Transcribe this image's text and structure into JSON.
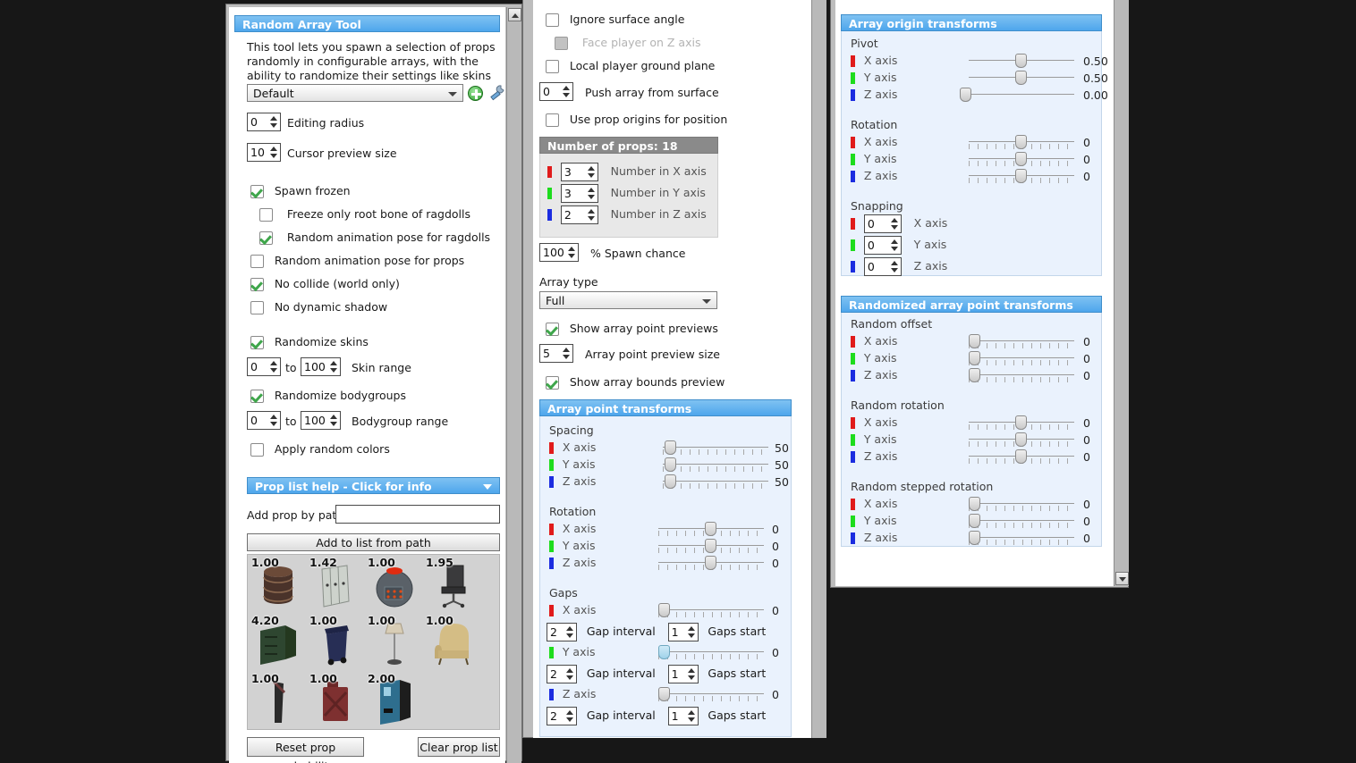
{
  "left_panel": {
    "title": "Random Array Tool",
    "description": "This tool lets you spawn a selection of props randomly in configurable arrays, with the ability to randomize their settings like skins and bodygroups.",
    "preset": {
      "value": "Default",
      "add_icon": "add-preset-icon",
      "wrench_icon": "edit-preset-icon"
    },
    "editing_radius": {
      "value": "0",
      "label": "Editing radius"
    },
    "cursor_preview_size": {
      "value": "10",
      "label": "Cursor preview size"
    },
    "checkboxes": [
      {
        "label": "Spawn frozen",
        "checked": true,
        "indent": 0
      },
      {
        "label": "Freeze only root bone of ragdolls",
        "checked": false,
        "indent": 1
      },
      {
        "label": "Random animation pose for ragdolls",
        "checked": true,
        "indent": 1
      },
      {
        "label": "Random animation pose for props",
        "checked": false,
        "indent": 0
      },
      {
        "label": "No collide (world only)",
        "checked": true,
        "indent": 0
      },
      {
        "label": "No dynamic shadow",
        "checked": false,
        "indent": 0
      },
      {
        "label": "Randomize skins",
        "checked": true,
        "indent": 0
      },
      {
        "label": "Randomize bodygroups",
        "checked": true,
        "indent": 0
      },
      {
        "label": "Apply random colors",
        "checked": false,
        "indent": 0
      }
    ],
    "skin_range": {
      "from": "0",
      "to_label": "to",
      "to": "100",
      "label": "Skin range"
    },
    "bodygroup_range": {
      "from": "0",
      "to_label": "to",
      "to": "100",
      "label": "Bodygroup range"
    },
    "prop_list": {
      "header": "Prop list help - Click for info",
      "add_by_path_label": "Add prop by path",
      "add_by_path_value": "",
      "add_button": "Add to list from path",
      "reset_button": "Reset prop probability",
      "clear_button": "Clear prop list",
      "props": [
        {
          "probability": "1.00",
          "icon": "prop-barrel"
        },
        {
          "probability": "1.42",
          "icon": "prop-lockers"
        },
        {
          "probability": "1.00",
          "icon": "prop-combine-ball"
        },
        {
          "probability": "1.95",
          "icon": "prop-office-chair"
        },
        {
          "probability": "4.20",
          "icon": "prop-filing-cabinet"
        },
        {
          "probability": "1.00",
          "icon": "prop-trash-bin"
        },
        {
          "probability": "1.00",
          "icon": "prop-floor-lamp"
        },
        {
          "probability": "1.00",
          "icon": "prop-armchair"
        },
        {
          "probability": "1.00",
          "icon": "prop-plank"
        },
        {
          "probability": "1.00",
          "icon": "prop-jerry-can"
        },
        {
          "probability": "2.00",
          "icon": "prop-vending-machine"
        }
      ]
    }
  },
  "middle_panel": {
    "checkboxes": [
      {
        "label": "Ignore surface angle",
        "checked": false,
        "disabled": false,
        "indent": 0
      },
      {
        "label": "Face player on Z axis",
        "checked": false,
        "disabled": true,
        "indent": 1
      },
      {
        "label": "Local player ground plane",
        "checked": false,
        "disabled": false,
        "indent": 0
      },
      {
        "label": "Use prop origins for position",
        "checked": false,
        "disabled": false,
        "indent": 0
      }
    ],
    "push_array": {
      "value": "0",
      "label": "Push array from surface"
    },
    "number_of_props": {
      "header": "Number of props: 18",
      "rows": [
        {
          "axis": "X",
          "color": "#e01b1b",
          "value": "3",
          "label": "Number in X axis"
        },
        {
          "axis": "Y",
          "color": "#1ddc1d",
          "value": "3",
          "label": "Number in Y axis"
        },
        {
          "axis": "Z",
          "color": "#1b2ce0",
          "value": "2",
          "label": "Number in Z axis"
        }
      ]
    },
    "spawn_chance": {
      "value": "100",
      "label": "% Spawn chance"
    },
    "array_type": {
      "label": "Array type",
      "value": "Full"
    },
    "show_point_previews": {
      "label": "Show array point previews",
      "checked": true
    },
    "point_preview_size": {
      "value": "5",
      "label": "Array point preview size"
    },
    "show_bounds_preview": {
      "label": "Show array bounds preview",
      "checked": true
    },
    "array_point_transforms": {
      "header": "Array point transforms",
      "spacing_label": "Spacing",
      "spacing": [
        {
          "axis": "X axis",
          "color": "#e01b1b",
          "value": "50",
          "pos": 2,
          "ticks": true
        },
        {
          "axis": "Y axis",
          "color": "#1ddc1d",
          "value": "50",
          "pos": 2,
          "ticks": true
        },
        {
          "axis": "Z axis",
          "color": "#1b2ce0",
          "value": "50",
          "pos": 2,
          "ticks": true
        }
      ],
      "rotation_label": "Rotation",
      "rotation": [
        {
          "axis": "X axis",
          "color": "#e01b1b",
          "value": "0",
          "pos": 50,
          "ticks": true
        },
        {
          "axis": "Y axis",
          "color": "#1ddc1d",
          "value": "0",
          "pos": 50,
          "ticks": true
        },
        {
          "axis": "Z axis",
          "color": "#1b2ce0",
          "value": "0",
          "pos": 50,
          "ticks": true
        }
      ],
      "gaps_label": "Gaps",
      "gaps": [
        {
          "axis": "X axis",
          "color": "#e01b1b",
          "value": "0",
          "pos": 0,
          "hot": false,
          "interval": "2",
          "interval_label": "Gap interval",
          "start": "1",
          "start_label": "Gaps start"
        },
        {
          "axis": "Y axis",
          "color": "#1ddc1d",
          "value": "0",
          "pos": 0,
          "hot": true,
          "interval": "2",
          "interval_label": "Gap interval",
          "start": "1",
          "start_label": "Gaps start"
        },
        {
          "axis": "Z axis",
          "color": "#1b2ce0",
          "value": "0",
          "pos": 0,
          "hot": false,
          "interval": "2",
          "interval_label": "Gap interval",
          "start": "1",
          "start_label": "Gaps start"
        }
      ]
    }
  },
  "right_panel": {
    "origin_transforms": {
      "header": "Array origin transforms",
      "pivot_label": "Pivot",
      "pivot": [
        {
          "axis": "X axis",
          "color": "#e01b1b",
          "value": "0.50",
          "pos": 50,
          "ticks": false
        },
        {
          "axis": "Y axis",
          "color": "#1ddc1d",
          "value": "0.50",
          "pos": 50,
          "ticks": false
        },
        {
          "axis": "Z axis",
          "color": "#1b2ce0",
          "value": "0.00",
          "pos": 0,
          "ticks": false
        }
      ],
      "rotation_label": "Rotation",
      "rotation": [
        {
          "axis": "X axis",
          "color": "#e01b1b",
          "value": "0",
          "pos": 50,
          "ticks": true
        },
        {
          "axis": "Y axis",
          "color": "#1ddc1d",
          "value": "0",
          "pos": 50,
          "ticks": true
        },
        {
          "axis": "Z axis",
          "color": "#1b2ce0",
          "value": "0",
          "pos": 50,
          "ticks": true
        }
      ],
      "snapping_label": "Snapping",
      "snapping": [
        {
          "color": "#e01b1b",
          "value": "0",
          "label": "X axis"
        },
        {
          "color": "#1ddc1d",
          "value": "0",
          "label": "Y axis"
        },
        {
          "color": "#1b2ce0",
          "value": "0",
          "label": "Z axis"
        }
      ]
    },
    "randomized_transforms": {
      "header": "Randomized array point transforms",
      "offset_label": "Random offset",
      "offset": [
        {
          "axis": "X axis",
          "color": "#e01b1b",
          "value": "0",
          "pos": 0,
          "ticks": true
        },
        {
          "axis": "Y axis",
          "color": "#1ddc1d",
          "value": "0",
          "pos": 0,
          "ticks": true
        },
        {
          "axis": "Z axis",
          "color": "#1b2ce0",
          "value": "0",
          "pos": 0,
          "ticks": true
        }
      ],
      "rotation_label": "Random rotation",
      "rotation": [
        {
          "axis": "X axis",
          "color": "#e01b1b",
          "value": "0",
          "pos": 50,
          "ticks": true
        },
        {
          "axis": "Y axis",
          "color": "#1ddc1d",
          "value": "0",
          "pos": 50,
          "ticks": true
        },
        {
          "axis": "Z axis",
          "color": "#1b2ce0",
          "value": "0",
          "pos": 50,
          "ticks": true
        }
      ],
      "stepped_label": "Random stepped rotation",
      "stepped": [
        {
          "axis": "X axis",
          "color": "#e01b1b",
          "value": "0",
          "pos": 0,
          "ticks": true
        },
        {
          "axis": "Y axis",
          "color": "#1ddc1d",
          "value": "0",
          "pos": 0,
          "ticks": true
        },
        {
          "axis": "Z axis",
          "color": "#1b2ce0",
          "value": "0",
          "pos": 0,
          "ticks": true
        }
      ]
    }
  }
}
